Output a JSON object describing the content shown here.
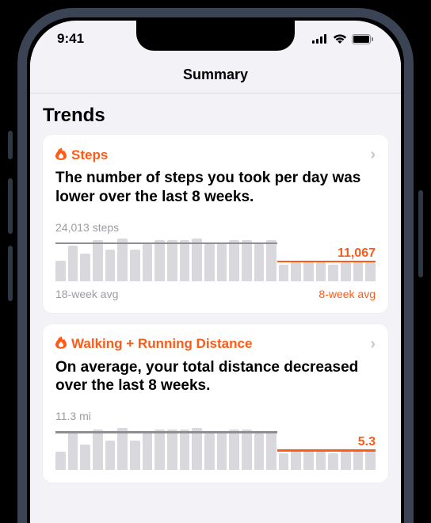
{
  "status": {
    "time": "9:41"
  },
  "nav": {
    "title": "Summary"
  },
  "section": {
    "title": "Trends"
  },
  "cards": [
    {
      "title": "Steps",
      "desc": "The number of steps you took per day was lower over the last 8 weeks.",
      "avg_long_label": "24,013 steps",
      "avg_short_label": "11,067",
      "footer_left": "18-week avg",
      "footer_right": "8-week avg"
    },
    {
      "title": "Walking + Running Distance",
      "desc": "On average, your total distance decreased over the last 8 weeks.",
      "avg_long_label": "11.3 mi",
      "avg_short_label": "5.3",
      "footer_left": "",
      "footer_right": ""
    }
  ],
  "chart_data": [
    {
      "type": "bar",
      "title": "Steps",
      "ylabel": "steps",
      "series": [
        {
          "name": "18-week avg",
          "value": 24013
        },
        {
          "name": "8-week avg",
          "value": 11067
        }
      ],
      "bars": [
        22,
        38,
        30,
        44,
        34,
        46,
        34,
        40,
        44,
        44,
        44,
        46,
        40,
        42,
        44,
        44,
        40,
        44,
        18,
        20,
        22,
        20,
        18,
        20,
        22,
        20
      ]
    },
    {
      "type": "bar",
      "title": "Walking + Running Distance",
      "ylabel": "mi",
      "series": [
        {
          "name": "18-week avg",
          "value": 11.3
        },
        {
          "name": "8-week avg",
          "value": 5.3
        }
      ],
      "bars": [
        20,
        42,
        28,
        44,
        32,
        46,
        32,
        42,
        44,
        44,
        44,
        46,
        40,
        42,
        44,
        44,
        40,
        42,
        18,
        20,
        22,
        20,
        18,
        20,
        22,
        20
      ]
    }
  ]
}
